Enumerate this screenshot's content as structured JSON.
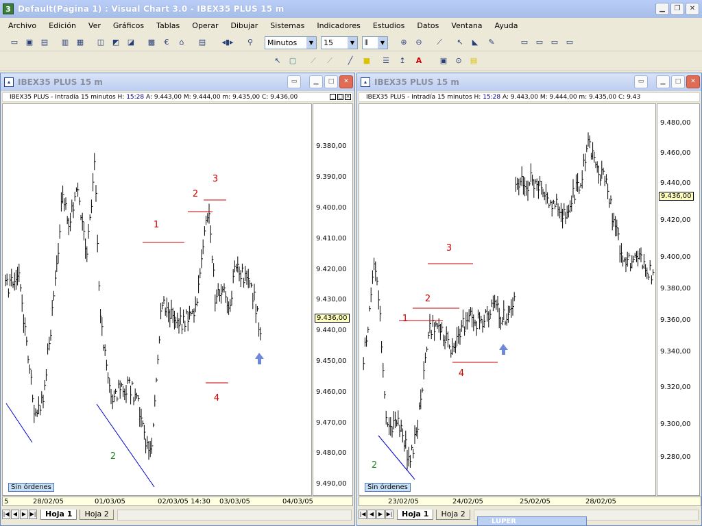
{
  "app": {
    "title": "Default(Página 1) : Visual Chart  3.0 - IBEX35 PLUS 15 m",
    "icon_label": "3"
  },
  "menu": [
    "Archivo",
    "Edición",
    "Ver",
    "Gráficos",
    "Tablas",
    "Operar",
    "Dibujar",
    "Sistemas",
    "Indicadores",
    "Estudios",
    "Datos",
    "Ventana",
    "Ayuda"
  ],
  "toolbar": {
    "period_unit": "Minutos",
    "period_value": "15"
  },
  "windows": [
    {
      "title": "IBEX35 PLUS 15 m",
      "info": {
        "prefix": "IBEX35 PLUS - Intradía 15 minutos  H: ",
        "time": "15:28",
        "rest": "  A: 9.443,00  M: 9.444,00  m: 9.435,00  C: 9.436,00"
      },
      "y_ticks": [
        "9.380,00",
        "9.390,00",
        "9.400,00",
        "9.410,00",
        "9.420,00",
        "9.430,00",
        "9.440,00",
        "9.450,00",
        "9.460,00",
        "9.470,00",
        "9.480,00",
        "9.490,00"
      ],
      "current_price": "9.436,00",
      "annotations": [
        "1",
        "2",
        "3",
        "4",
        "2"
      ],
      "date_labels": [
        "5",
        "28/02/05",
        "01/03/05",
        "02/03/05 14:30",
        "03/03/05",
        "04/03/05"
      ],
      "orders_label": "Sin órdenes",
      "sheets": [
        "Hoja 1",
        "Hoja 2"
      ]
    },
    {
      "title": "IBEX35 PLUS 15 m",
      "info": {
        "prefix": "IBEX35 PLUS - Intradía 15 minutos  H: ",
        "time": "15:28",
        "rest": "  A: 9.443,00  M: 9.444,00  m: 9.435,00  C: 9.43"
      },
      "y_ticks": [
        "9.480,00",
        "9.460,00",
        "9.440,00",
        "9.420,00",
        "9.400,00",
        "9.380,00",
        "9.360,00",
        "9.340,00",
        "9.320,00",
        "9.300,00",
        "9.280,00"
      ],
      "current_price": "9.436,00",
      "annotations": [
        "1",
        "2",
        "3",
        "4",
        "2"
      ],
      "date_labels": [
        "23/02/05",
        "24/02/05",
        "25/02/05",
        "28/02/05"
      ],
      "orders_label": "Sin órdenes",
      "sheets": [
        "Hoja 1",
        "Hoja 2"
      ]
    }
  ],
  "mini_window": {
    "title": "LUPER"
  },
  "colors": {
    "bars": "#000000",
    "levels": "#cc0000",
    "trend": "#0000cc",
    "label_green": "#228822",
    "arrow": "#6f88d8"
  },
  "icons": [
    "open-icon",
    "save-icon",
    "bar-chart-icon",
    "zoom-in-icon",
    "zoom-out-icon",
    "cursor-icon",
    "line-icon",
    "text-icon",
    "arrow-up-icon"
  ]
}
